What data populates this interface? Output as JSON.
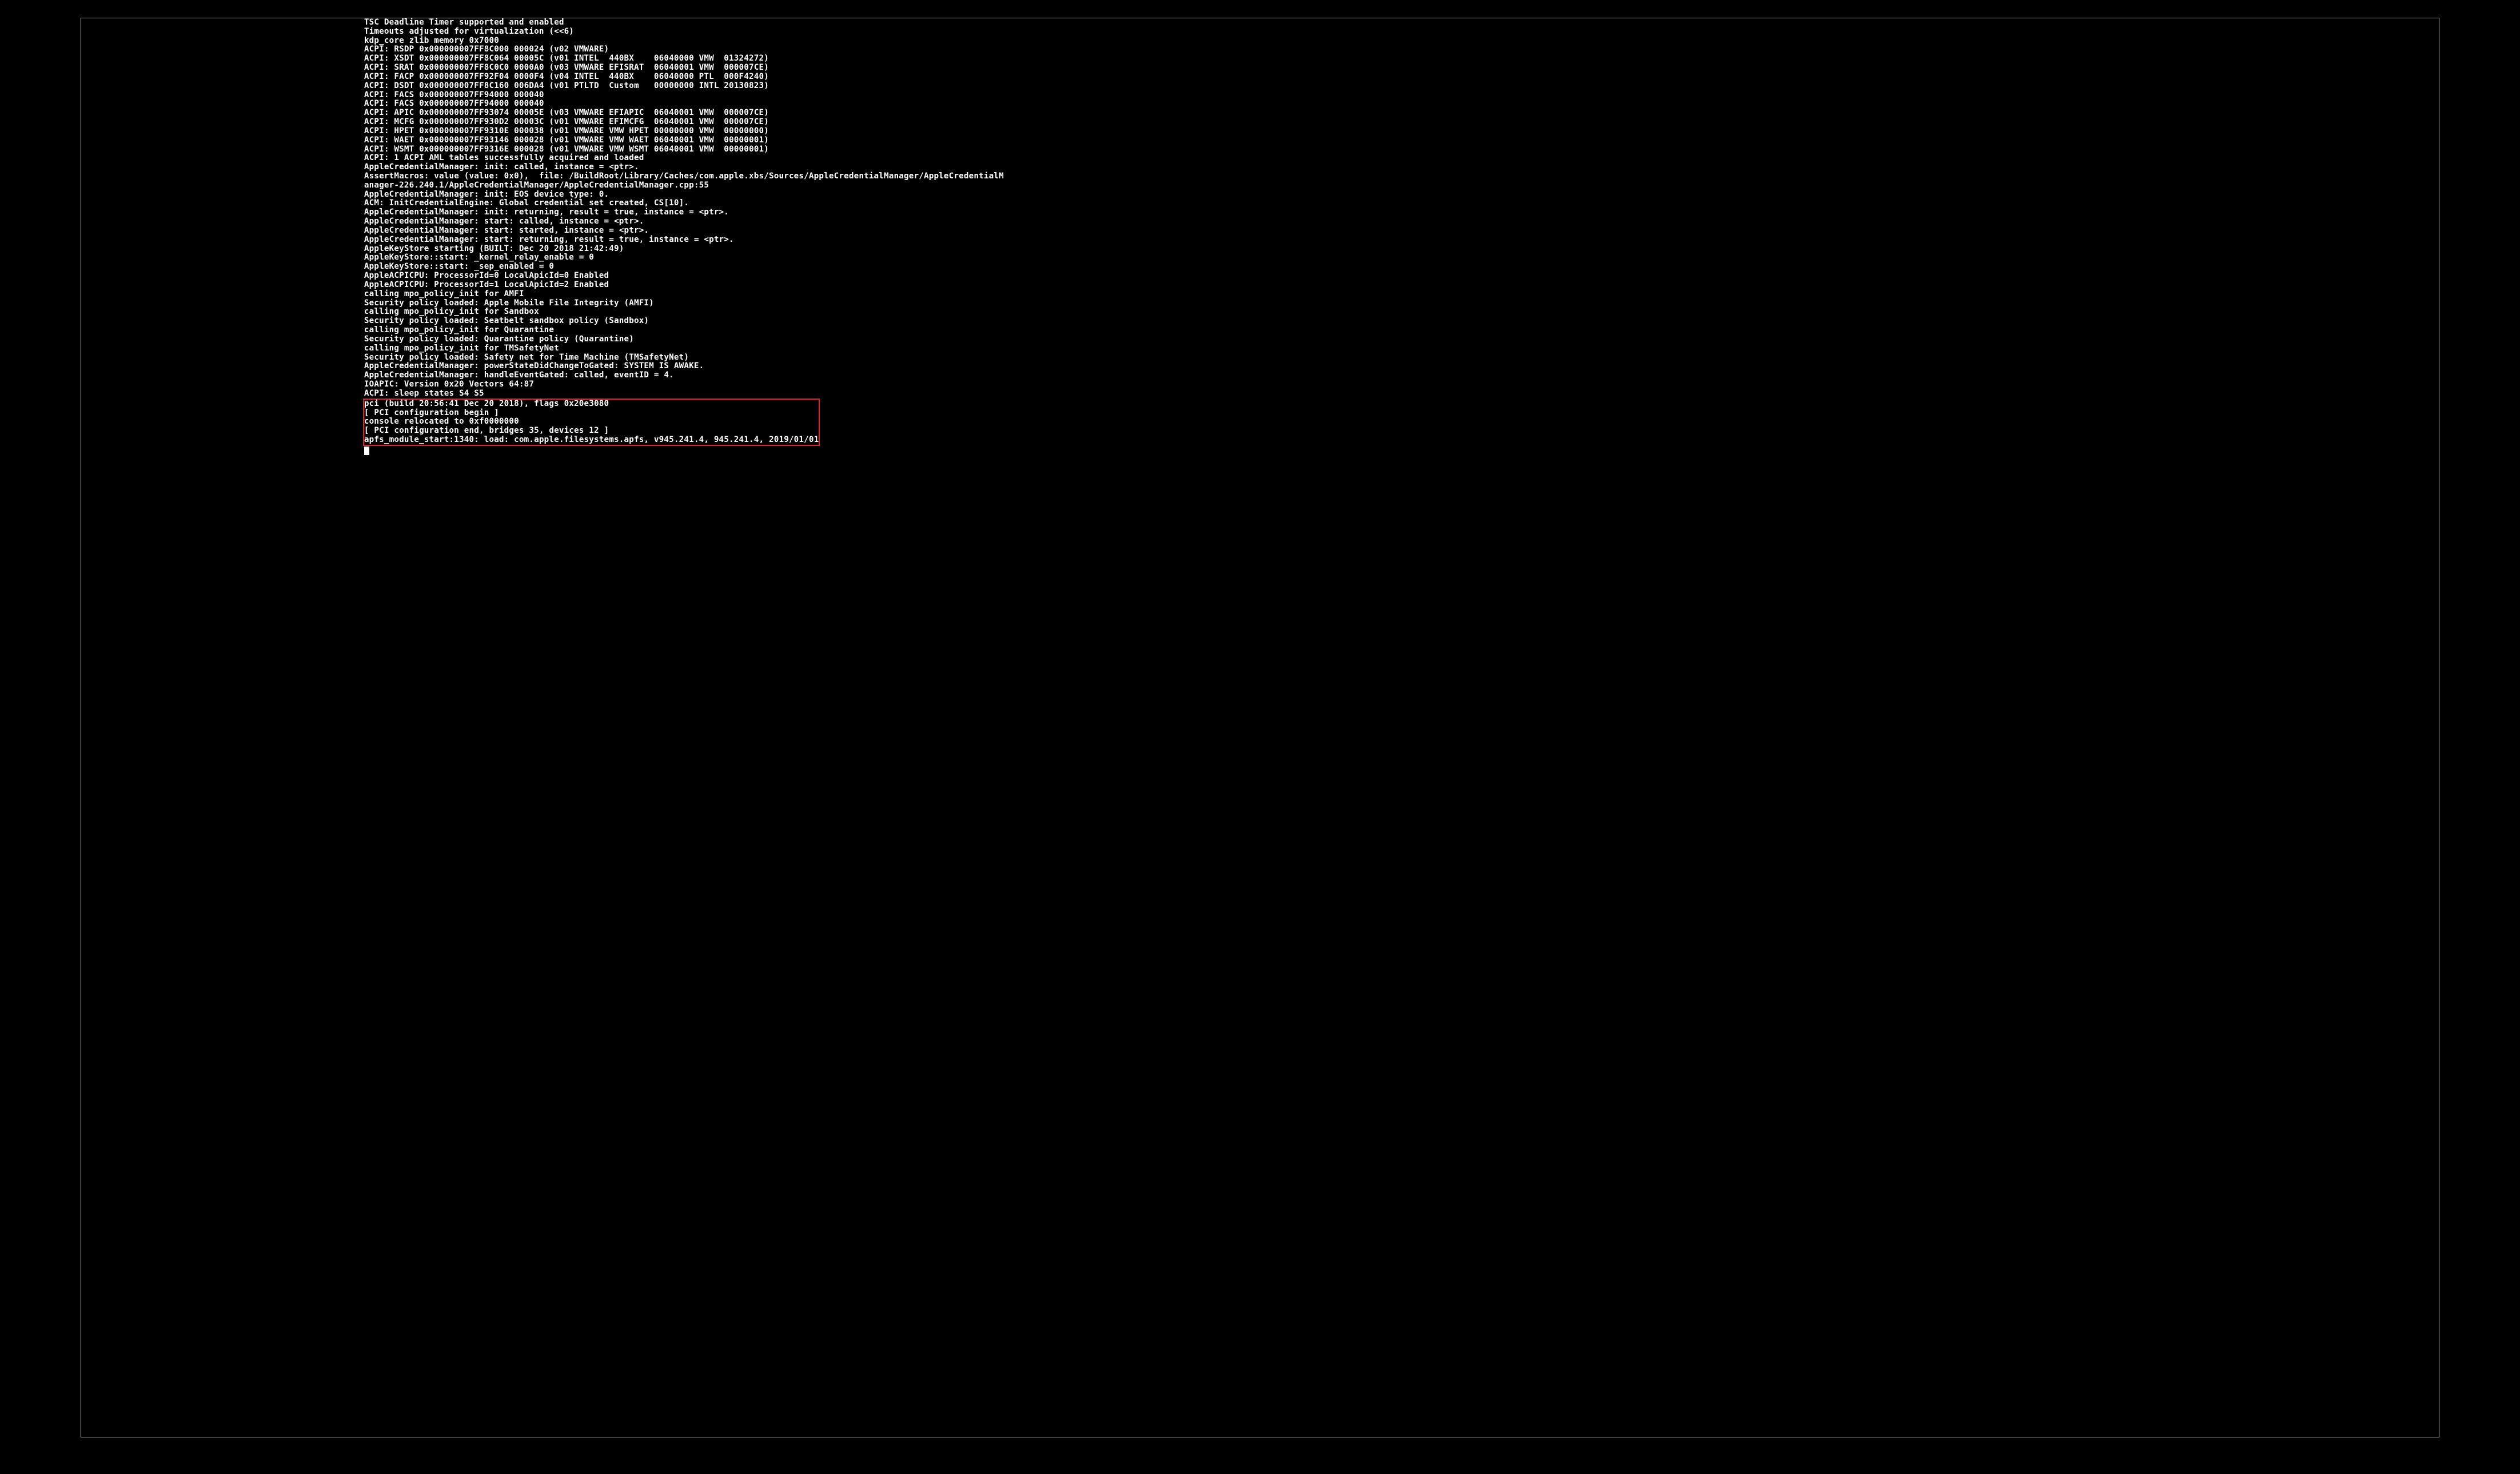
{
  "colors": {
    "bg": "#000000",
    "fg": "#ffffff",
    "border": "#bfbfbf",
    "highlight": "#e22424"
  },
  "log_lines": [
    "TSC Deadline Timer supported and enabled",
    "Timeouts adjusted for virtualization (<<6)",
    "kdp_core zlib memory 0x7000",
    "ACPI: RSDP 0x000000007FF8C000 000024 (v02 VMWARE)",
    "ACPI: XSDT 0x000000007FF8C064 00005C (v01 INTEL  440BX    06040000 VMW  01324272)",
    "ACPI: SRAT 0x000000007FF8C0C0 0000A0 (v03 VMWARE EFISRAT  06040001 VMW  000007CE)",
    "ACPI: FACP 0x000000007FF92F04 0000F4 (v04 INTEL  440BX    06040000 PTL  000F4240)",
    "ACPI: DSDT 0x000000007FF8C160 006DA4 (v01 PTLTD  Custom   00000000 INTL 20130823)",
    "ACPI: FACS 0x000000007FF94000 000040",
    "ACPI: FACS 0x000000007FF94000 000040",
    "ACPI: APIC 0x000000007FF93074 00005E (v03 VMWARE EFIAPIC  06040001 VMW  000007CE)",
    "ACPI: MCFG 0x000000007FF930D2 00003C (v01 VMWARE EFIMCFG  06040001 VMW  000007CE)",
    "ACPI: HPET 0x000000007FF9310E 000038 (v01 VMWARE VMW HPET 00000000 VMW  00000000)",
    "ACPI: WAET 0x000000007FF93146 000028 (v01 VMWARE VMW WAET 06040001 VMW  00000001)",
    "ACPI: WSMT 0x000000007FF9316E 000028 (v01 VMWARE VMW WSMT 06040001 VMW  00000001)",
    "ACPI: 1 ACPI AML tables successfully acquired and loaded",
    "AppleCredentialManager: init: called, instance = <ptr>.",
    "AssertMacros: value (value: 0x0),  file: /BuildRoot/Library/Caches/com.apple.xbs/Sources/AppleCredentialManager/AppleCredentialM",
    "anager-226.240.1/AppleCredentialManager/AppleCredentialManager.cpp:55",
    "AppleCredentialManager: init: EOS device type: 0.",
    "ACM: InitCredentialEngine: Global credential set created, CS[10].",
    "AppleCredentialManager: init: returning, result = true, instance = <ptr>.",
    "AppleCredentialManager: start: called, instance = <ptr>.",
    "AppleCredentialManager: start: started, instance = <ptr>.",
    "AppleCredentialManager: start: returning, result = true, instance = <ptr>.",
    "AppleKeyStore starting (BUILT: Dec 20 2018 21:42:49)",
    "AppleKeyStore::start: _kernel_relay_enable = 0",
    "AppleKeyStore::start: _sep_enabled = 0",
    "AppleACPICPU: ProcessorId=0 LocalApicId=0 Enabled",
    "AppleACPICPU: ProcessorId=1 LocalApicId=2 Enabled",
    "calling mpo_policy_init for AMFI",
    "Security policy loaded: Apple Mobile File Integrity (AMFI)",
    "calling mpo_policy_init for Sandbox",
    "Security policy loaded: Seatbelt sandbox policy (Sandbox)",
    "calling mpo_policy_init for Quarantine",
    "Security policy loaded: Quarantine policy (Quarantine)",
    "calling mpo_policy_init for TMSafetyNet",
    "Security policy loaded: Safety net for Time Machine (TMSafetyNet)",
    "AppleCredentialManager: powerStateDidChangeToGated: SYSTEM IS AWAKE.",
    "AppleCredentialManager: handleEventGated: called, eventID = 4.",
    "IOAPIC: Version 0x20 Vectors 64:87",
    "ACPI: sleep states S4 S5"
  ],
  "highlighted_lines": [
    "pci (build 20:56:41 Dec 20 2018), flags 0x20e3080",
    "[ PCI configuration begin ]",
    "console relocated to 0xf0000000",
    "[ PCI configuration end, bridges 35, devices 12 ]",
    "apfs_module_start:1340: load: com.apple.filesystems.apfs, v945.241.4, 945.241.4, 2019/01/01"
  ]
}
